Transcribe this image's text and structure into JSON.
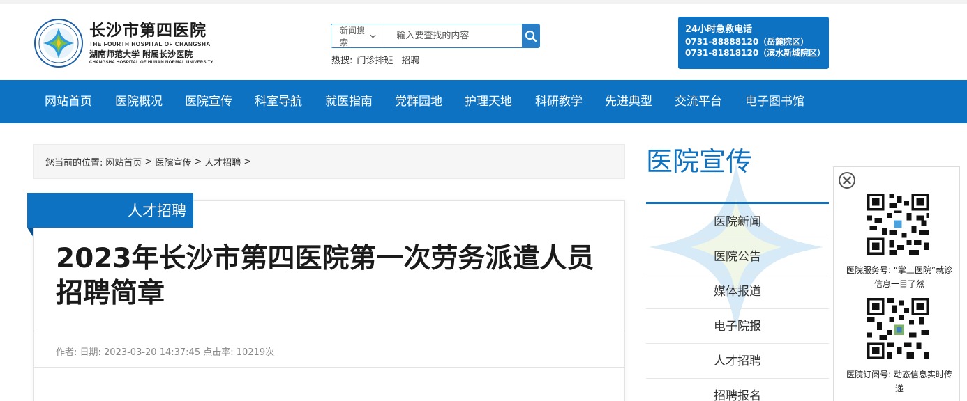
{
  "header": {
    "logo": {
      "name_cn": "长沙市第四医院",
      "name_en": "THE FOURTH HOSPITAL OF CHANGSHA",
      "affiliation_cn": "湖南师范大学 附属长沙医院",
      "affiliation_en": "CHANGSHA HOSPITAL OF HUNAN NORMAL UNIVERSITY",
      "icon": "hospital-emblem-icon"
    },
    "search": {
      "select_value": "新闻搜索",
      "placeholder": "输入要查找的内容",
      "button_icon": "search-icon"
    },
    "hot": {
      "label": "热搜:",
      "links": [
        "门诊排班",
        "招聘"
      ]
    },
    "emergency": {
      "title": "24小时急救电话",
      "lines": [
        "0731-88888120（岳麓院区）",
        "0731-81818120（滨水新城院区）"
      ]
    }
  },
  "nav": {
    "items": [
      "网站首页",
      "医院概况",
      "医院宣传",
      "科室导航",
      "就医指南",
      "党群园地",
      "护理天地",
      "科研教学",
      "先进典型",
      "交流平台",
      "电子图书馆"
    ]
  },
  "breadcrumb": {
    "prefix": "您当前的位置:",
    "items": [
      "网站首页",
      ">",
      "医院宣传",
      ">",
      "人才招聘",
      ">"
    ]
  },
  "article": {
    "category": "人才招聘",
    "title": "2023年长沙市第四医院第一次劳务派遣人员招聘简章",
    "meta": "作者:  日期: 2023-03-20 14:37:45 点击率: 10219次"
  },
  "sidebar": {
    "title": "医院宣传",
    "items": [
      "医院新闻",
      "医院公告",
      "媒体报道",
      "电子院报",
      "人才招聘",
      "招聘报名"
    ]
  },
  "qr_panel": {
    "close_icon": "close-icon",
    "service_text": "医院服务号: “掌上医院”就诊信息一目了然",
    "subscription_text": "医院订阅号: 动态信息实时传递"
  },
  "colors": {
    "brand_blue": "#0d72c2",
    "search_blue": "#2a7ec6"
  }
}
